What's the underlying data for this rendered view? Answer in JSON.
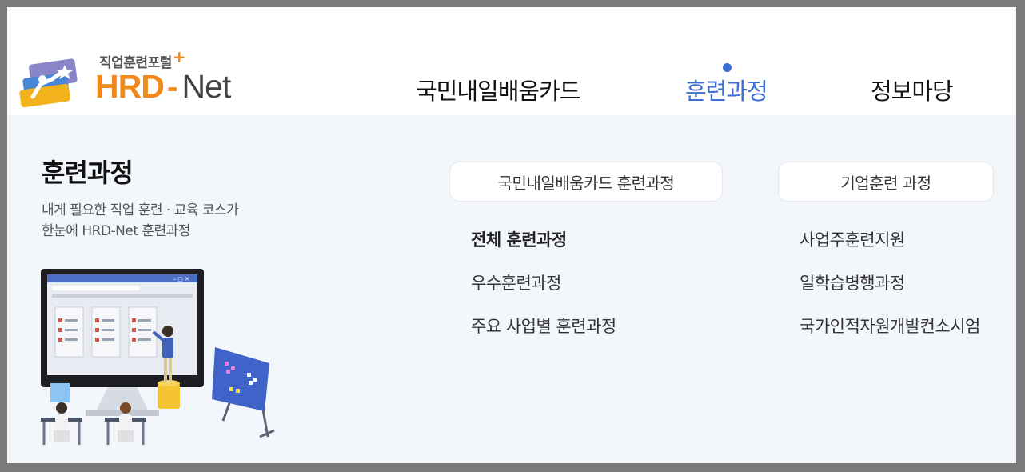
{
  "logo": {
    "subtitle": "직업훈련포털",
    "plus": "+",
    "brand_hrd": "HRD",
    "brand_dash": "-",
    "brand_net": "Net",
    "colors": {
      "orange": "#f08a1c",
      "gray": "#444444"
    }
  },
  "nav": {
    "items": [
      {
        "label": "국민내일배움카드",
        "active": false
      },
      {
        "label": "훈련과정",
        "active": true
      },
      {
        "label": "정보마당",
        "active": false
      }
    ],
    "active_color": "#3b6fd4"
  },
  "panel": {
    "title": "훈련과정",
    "desc_line1": "내게 필요한 직업 훈련 · 교육 코스가",
    "desc_line2": "한눈에 HRD-Net 훈련과정",
    "categories": [
      {
        "label": "국민내일배움카드 훈련과정",
        "links": [
          {
            "label": "전체 훈련과정",
            "bold": true
          },
          {
            "label": "우수훈련과정",
            "bold": false
          },
          {
            "label": "주요 사업별 훈련과정",
            "bold": false
          }
        ]
      },
      {
        "label": "기업훈련 과정",
        "links": [
          {
            "label": "사업주훈련지원",
            "bold": false
          },
          {
            "label": "일학습병행과정",
            "bold": false
          },
          {
            "label": "국가인적자원개발컨소시엄",
            "bold": false
          }
        ]
      }
    ],
    "background": "#f3f7fc"
  },
  "illustration": {
    "icon": "classroom-presentation-illustration",
    "window_controls": "– ▢ ✕"
  }
}
